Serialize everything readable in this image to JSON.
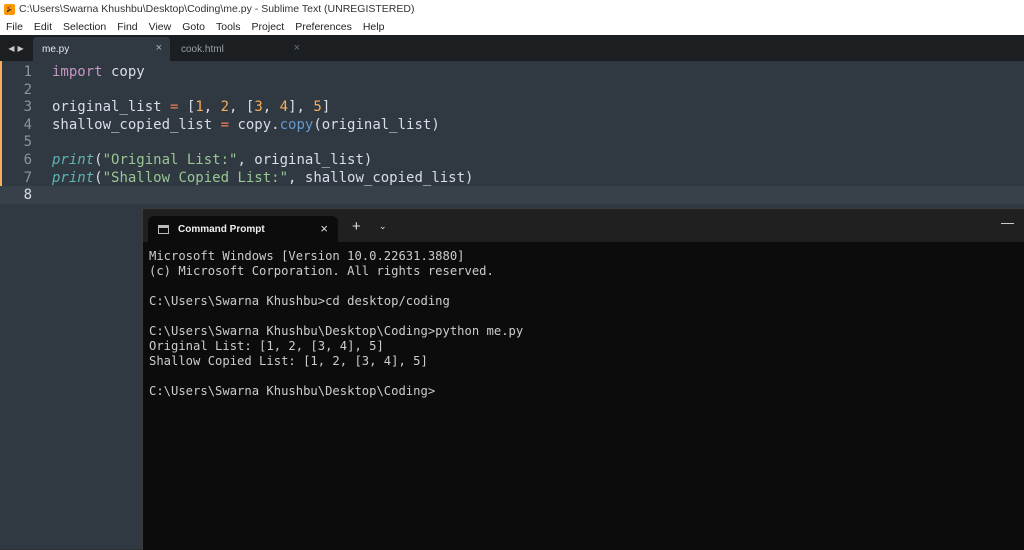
{
  "window": {
    "title": "C:\\Users\\Swarna Khushbu\\Desktop\\Coding\\me.py - Sublime Text (UNREGISTERED)"
  },
  "menu": [
    "File",
    "Edit",
    "Selection",
    "Find",
    "View",
    "Goto",
    "Tools",
    "Project",
    "Preferences",
    "Help"
  ],
  "tabs": [
    {
      "label": "me.py",
      "active": true
    },
    {
      "label": "cook.html",
      "active": false
    }
  ],
  "editor": {
    "lines": [
      {
        "n": "1",
        "tokens": [
          {
            "t": "import",
            "c": "kw"
          },
          {
            "t": " copy",
            "c": "plain"
          }
        ]
      },
      {
        "n": "2",
        "tokens": []
      },
      {
        "n": "3",
        "tokens": [
          {
            "t": "original_list ",
            "c": "plain"
          },
          {
            "t": "=",
            "c": "op"
          },
          {
            "t": " [",
            "c": "plain"
          },
          {
            "t": "1",
            "c": "num"
          },
          {
            "t": ", ",
            "c": "plain"
          },
          {
            "t": "2",
            "c": "num"
          },
          {
            "t": ", [",
            "c": "plain"
          },
          {
            "t": "3",
            "c": "num"
          },
          {
            "t": ", ",
            "c": "plain"
          },
          {
            "t": "4",
            "c": "num"
          },
          {
            "t": "], ",
            "c": "plain"
          },
          {
            "t": "5",
            "c": "num"
          },
          {
            "t": "]",
            "c": "plain"
          }
        ]
      },
      {
        "n": "4",
        "tokens": [
          {
            "t": "shallow_copied_list ",
            "c": "plain"
          },
          {
            "t": "=",
            "c": "op"
          },
          {
            "t": " copy.",
            "c": "plain"
          },
          {
            "t": "copy",
            "c": "meth"
          },
          {
            "t": "(original_list)",
            "c": "plain"
          }
        ]
      },
      {
        "n": "5",
        "tokens": []
      },
      {
        "n": "6",
        "tokens": [
          {
            "t": "print",
            "c": "fn"
          },
          {
            "t": "(",
            "c": "plain"
          },
          {
            "t": "\"Original List:\"",
            "c": "str"
          },
          {
            "t": ", original_list)",
            "c": "plain"
          }
        ]
      },
      {
        "n": "7",
        "tokens": [
          {
            "t": "print",
            "c": "fn"
          },
          {
            "t": "(",
            "c": "plain"
          },
          {
            "t": "\"Shallow Copied List:\"",
            "c": "str"
          },
          {
            "t": ", shallow_copied_list)",
            "c": "plain"
          }
        ]
      },
      {
        "n": "8",
        "tokens": []
      }
    ]
  },
  "terminal": {
    "tab_label": "Command Prompt",
    "lines": [
      "Microsoft Windows [Version 10.0.22631.3880]",
      "(c) Microsoft Corporation. All rights reserved.",
      "",
      "C:\\Users\\Swarna Khushbu>cd desktop/coding",
      "",
      "C:\\Users\\Swarna Khushbu\\Desktop\\Coding>python me.py",
      "Original List: [1, 2, [3, 4], 5]",
      "Shallow Copied List: [1, 2, [3, 4], 5]",
      "",
      "C:\\Users\\Swarna Khushbu\\Desktop\\Coding>"
    ]
  }
}
